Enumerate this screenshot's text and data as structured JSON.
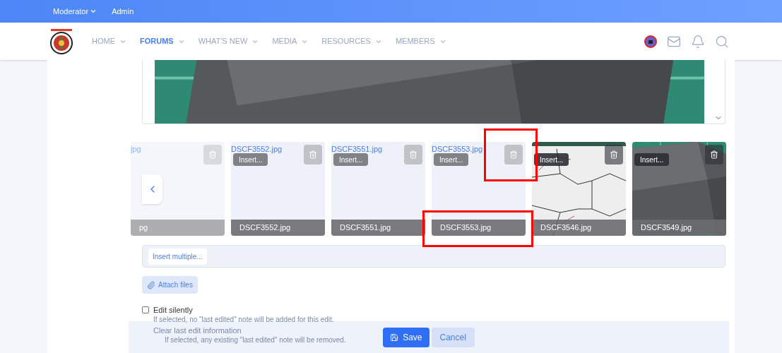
{
  "top_nav": [
    {
      "label": "Moderator",
      "dropdown": true
    },
    {
      "label": "Admin",
      "dropdown": false
    }
  ],
  "nav_tabs": [
    {
      "label": "HOME",
      "selected": false
    },
    {
      "label": "FORUMS",
      "selected": true
    },
    {
      "label": "WHAT'S NEW",
      "selected": false
    },
    {
      "label": "MEDIA",
      "selected": false
    },
    {
      "label": "RESOURCES",
      "selected": false
    },
    {
      "label": "MEMBERS",
      "selected": false
    }
  ],
  "attachments": [
    {
      "kind": "faded",
      "link": "jpg",
      "name": "pg",
      "highlighted": false
    },
    {
      "kind": "blank",
      "link": "DSCF3552.jpg",
      "insert": "Insert...",
      "name": "DSCF3552.jpg",
      "highlighted": false
    },
    {
      "kind": "blank",
      "link": "DSCF3551.jpg",
      "insert": "Insert...",
      "name": "DSCF3551.jpg",
      "highlighted": false
    },
    {
      "kind": "blank",
      "link": "DSCF3553.jpg",
      "insert": "Insert...",
      "name": "DSCF3553.jpg",
      "highlighted": true
    },
    {
      "kind": "template",
      "insert": "Insert...",
      "name": "DSCF3546.jpg",
      "highlighted": false
    },
    {
      "insert": "Insert...",
      "name": "DSCF3549.jpg",
      "highlighted": false
    }
  ],
  "insert_multiple": "Insert multiple...",
  "attach_button": "Attach files",
  "options": [
    {
      "label": "Edit silently",
      "checked": false,
      "hint": "If selected, no \"last edited\" note will be added for this edit."
    },
    {
      "label": "Clear last edit information",
      "hint": "If selected, any existing \"last edited\" note will be removed."
    }
  ],
  "buttons": {
    "save": "Save",
    "cancel": "Cancel"
  }
}
